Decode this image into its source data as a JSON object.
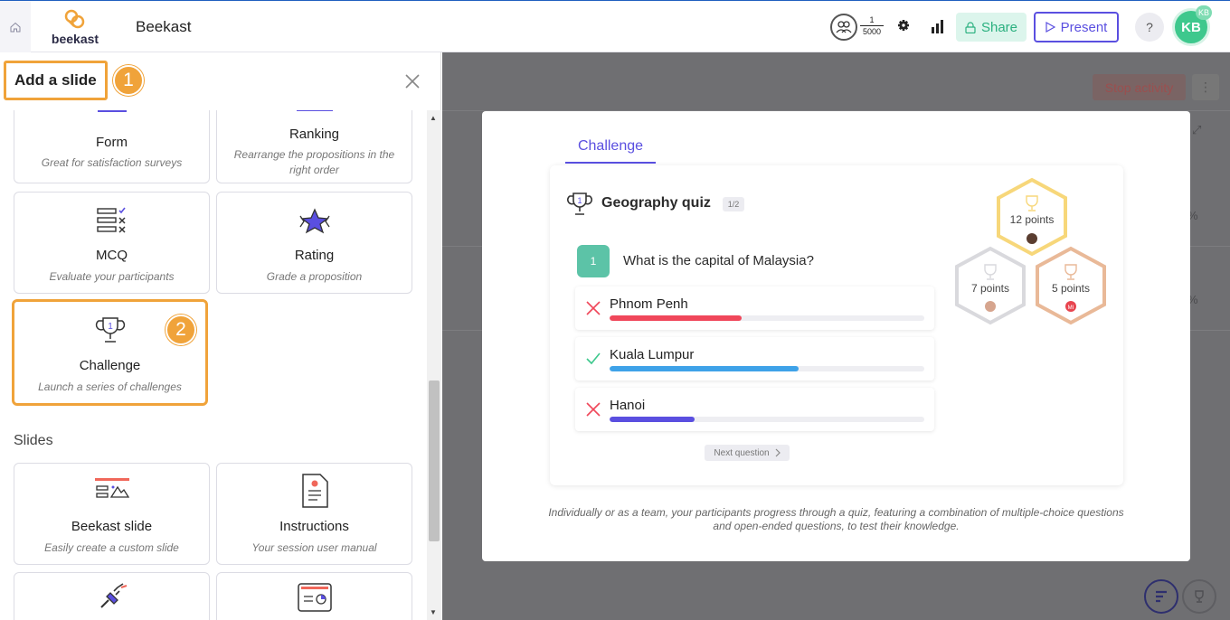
{
  "header": {
    "home_icon": "home-icon",
    "logo_text": "beekast",
    "title": "Beekast",
    "participants_current": "1",
    "participants_max": "5000",
    "share_label": "Share",
    "present_label": "Present",
    "help_label": "?",
    "avatar_initials": "KB",
    "avatar_badge": "KB"
  },
  "panel": {
    "title": "Add a slide",
    "step1": "1",
    "step2": "2",
    "cards_top": [
      {
        "title": "Form",
        "desc": "Great for satisfaction surveys",
        "icon": "form-icon"
      },
      {
        "title": "Ranking",
        "desc": "Rearrange the propositions in the right order",
        "icon": "ranking-icon"
      },
      {
        "title": "MCQ",
        "desc": "Evaluate your participants",
        "icon": "mcq-icon"
      },
      {
        "title": "Rating",
        "desc": "Grade a proposition",
        "icon": "rating-icon"
      },
      {
        "title": "Challenge",
        "desc": "Launch a series of challenges",
        "icon": "trophy-icon"
      }
    ],
    "slides_section": "Slides",
    "cards_slides": [
      {
        "title": "Beekast slide",
        "desc": "Easily create a custom slide",
        "icon": "slide-icon"
      },
      {
        "title": "Instructions",
        "desc": "Your session user manual",
        "icon": "instructions-icon"
      }
    ]
  },
  "background": {
    "stop_label": "Stop activity",
    "pct1": "%",
    "pct2": "%"
  },
  "modal": {
    "tab": "Challenge",
    "quiz_title": "Geography quiz",
    "quiz_count": "1/2",
    "question_number": "1",
    "question": "What is the capital of Malaysia?",
    "answers": [
      {
        "label": "Phnom Penh",
        "correct": false,
        "fill": 0.42,
        "color": "#f0475a"
      },
      {
        "label": "Kuala Lumpur",
        "correct": true,
        "fill": 0.6,
        "color": "#3ea2e8"
      },
      {
        "label": "Hanoi",
        "correct": false,
        "fill": 0.27,
        "color": "#5a4fe0"
      }
    ],
    "next_label": "Next question",
    "hexes": [
      {
        "label": "12 points",
        "color": "#f7d77a"
      },
      {
        "label": "7 points",
        "color": "#d9d9dd"
      },
      {
        "label": "5 points",
        "color": "#e9b998",
        "badge": "MI"
      }
    ],
    "description": "Individually or as a team, your participants progress through a quiz, featuring a combination of multiple-choice questions and open-ended questions, to test their knowledge."
  }
}
